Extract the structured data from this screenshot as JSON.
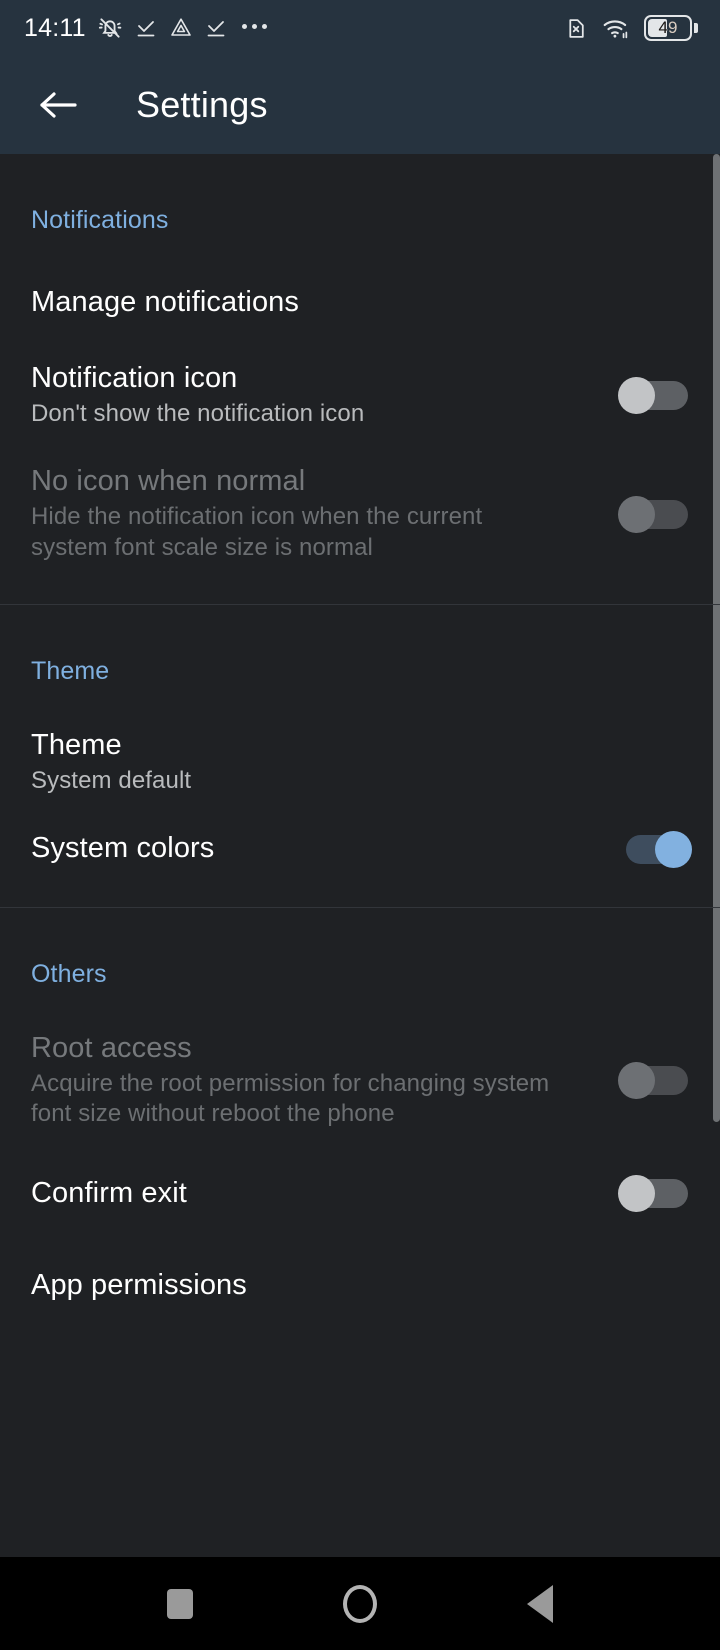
{
  "statusbar": {
    "time": "14:11",
    "left_icons": [
      {
        "name": "bell-muted-icon",
        "label": "Silent mode"
      },
      {
        "name": "download-complete-icon",
        "label": "Download complete"
      },
      {
        "name": "drive-icon",
        "label": "Drive"
      },
      {
        "name": "download-complete-icon-2",
        "label": "Download complete"
      },
      {
        "name": "more-notifications-icon",
        "label": "More notifications"
      }
    ],
    "right_icons": [
      {
        "name": "no-sim-icon",
        "label": "No SIM"
      },
      {
        "name": "wifi-icon",
        "label": "Wi-Fi connected"
      }
    ],
    "battery_level": "49"
  },
  "appbar": {
    "back_label": "Back",
    "title": "Settings"
  },
  "sections": [
    {
      "header": "Notifications",
      "rows": [
        {
          "title": "Manage notifications",
          "summary": "",
          "control": "none",
          "state": "",
          "disabled": false
        },
        {
          "title": "Notification icon",
          "summary": "Don't show the notification icon",
          "control": "switch",
          "state": "off",
          "disabled": false
        },
        {
          "title": "No icon when normal",
          "summary": "Hide the notification icon when the current system font scale size is normal",
          "control": "switch",
          "state": "off",
          "disabled": true
        }
      ]
    },
    {
      "header": "Theme",
      "rows": [
        {
          "title": "Theme",
          "summary": "System default",
          "control": "none",
          "state": "",
          "disabled": false
        },
        {
          "title": "System colors",
          "summary": "",
          "control": "switch",
          "state": "on",
          "disabled": false
        }
      ]
    },
    {
      "header": "Others",
      "rows": [
        {
          "title": "Root access",
          "summary": "Acquire the root permission for changing system font size without reboot the phone",
          "control": "switch",
          "state": "off",
          "disabled": true
        },
        {
          "title": "Confirm exit",
          "summary": "",
          "control": "switch",
          "state": "off",
          "disabled": false
        },
        {
          "title": "App permissions",
          "summary": "",
          "control": "none",
          "state": "",
          "disabled": false
        }
      ]
    }
  ],
  "navbar": {
    "recents_label": "Recents",
    "home_label": "Home",
    "back_label": "Back"
  },
  "colors": {
    "accent": "#7fb0e0",
    "background": "#1f2124",
    "appbar": "#26333f",
    "switch_on_thumb": "#82b1e0",
    "switch_on_track": "#3e4d5e"
  }
}
